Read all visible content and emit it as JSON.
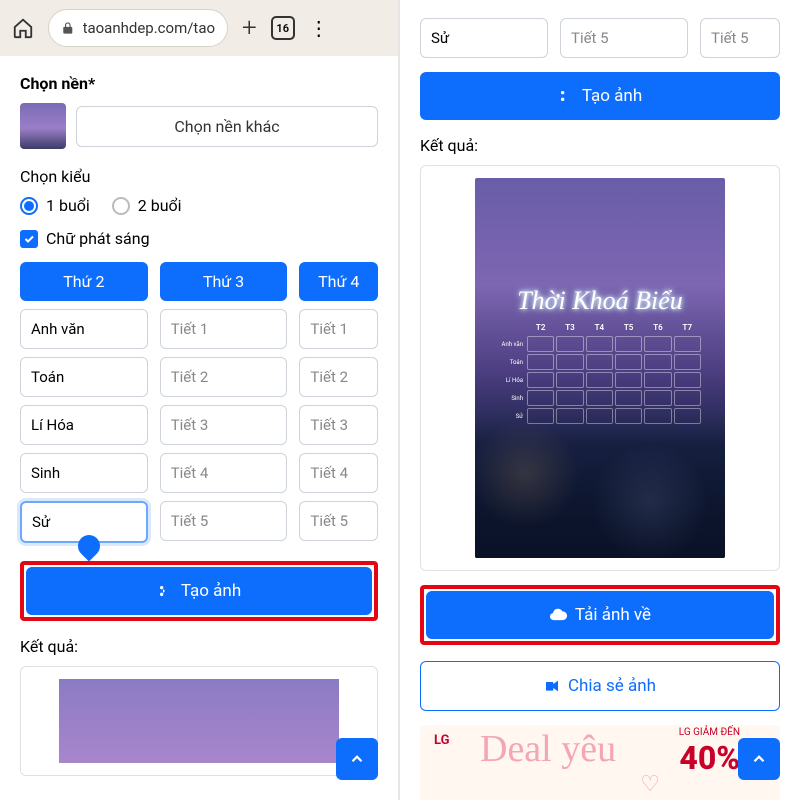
{
  "browser": {
    "url": "taoanhdep.com/tao-",
    "tab_count": "16"
  },
  "left": {
    "bg_label": "Chọn nền*",
    "bg_button": "Chọn nền khác",
    "style_label": "Chọn kiểu",
    "radio_1": "1 buổi",
    "radio_2": "2 buổi",
    "glow_label": "Chữ phát sáng",
    "days": [
      "Thứ 2",
      "Thứ 3",
      "Thứ 4"
    ],
    "col1": [
      "Anh văn",
      "Toán",
      "Lí Hóa",
      "Sinh",
      "Sử"
    ],
    "col2_ph": [
      "Tiết 1",
      "Tiết 2",
      "Tiết 3",
      "Tiết 4",
      "Tiết 5"
    ],
    "col3_ph": [
      "Tiết 1",
      "Tiết 2",
      "Tiết 3",
      "Tiết 4",
      "Tiết 5"
    ],
    "create_btn": "Tạo ảnh",
    "result_label": "Kết quả:"
  },
  "right": {
    "top_input_val": "Sử",
    "top_ph_1": "Tiết 5",
    "top_ph_2": "Tiết 5",
    "create_btn": "Tạo ảnh",
    "result_label": "Kết quả:",
    "tkb_title": "Thời Khoá Biểu",
    "tkb_days": [
      "T2",
      "T3",
      "T4",
      "T5",
      "T6",
      "T7"
    ],
    "tkb_rows": [
      "Anh văn",
      "Toán",
      "Lí Hóa",
      "Sinh",
      "Sử"
    ],
    "download_btn": "Tải ảnh về",
    "share_btn": "Chia sẻ ảnh",
    "banner": {
      "brand": "LG",
      "deal": "Deal yêu",
      "sub": "LG GIẢM ĐẾN",
      "pct": "40%"
    }
  }
}
